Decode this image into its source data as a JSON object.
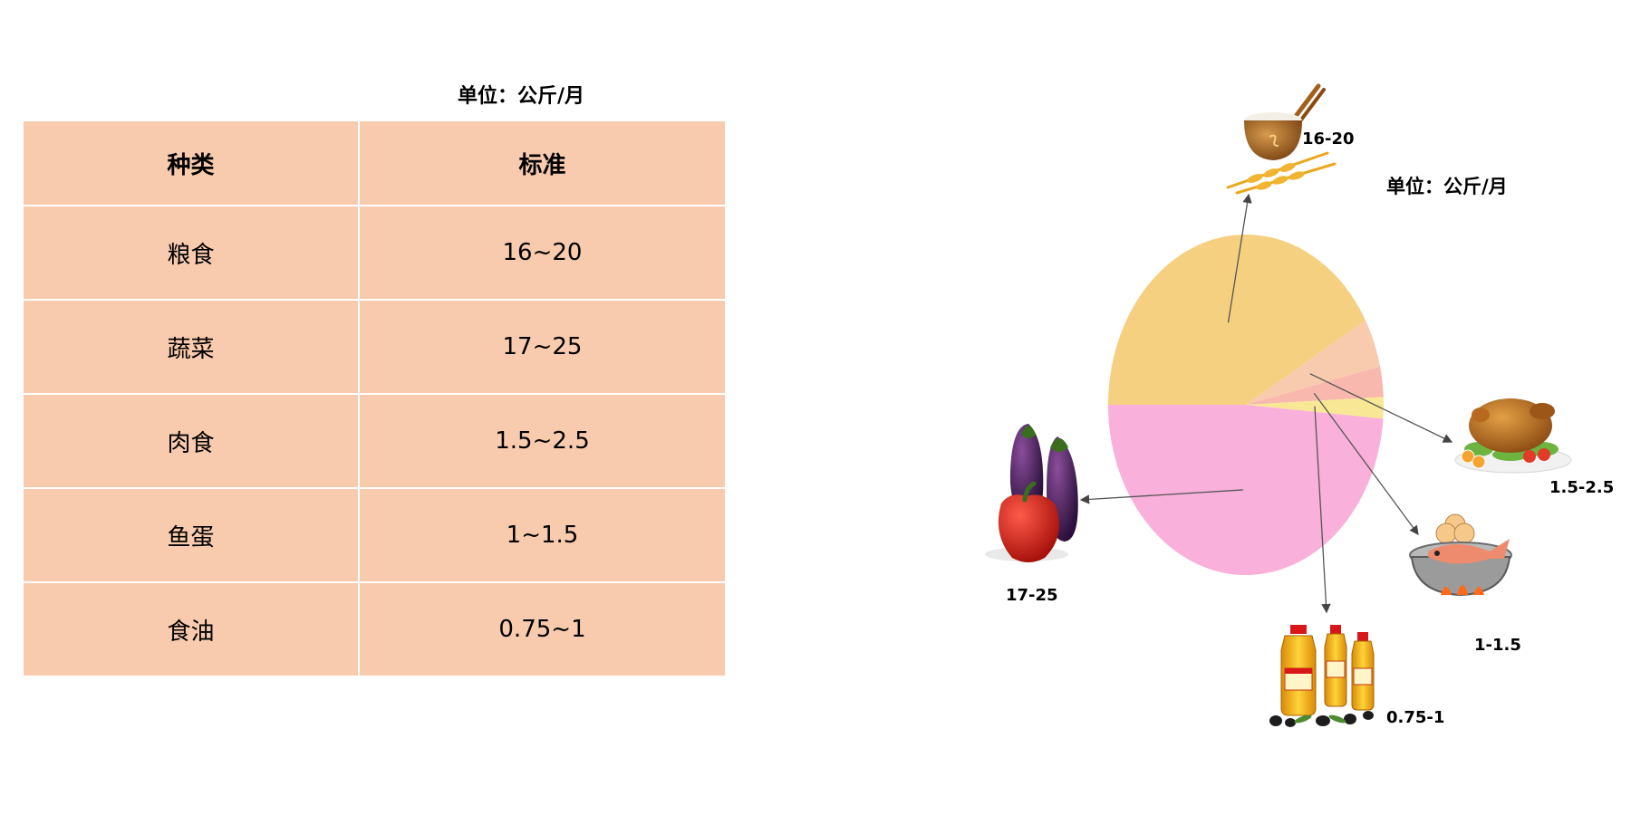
{
  "table": {
    "unit": "单位：公斤/月",
    "headers": [
      "种类",
      "标准"
    ],
    "rows": [
      {
        "category": "粮食",
        "standard": "16~20"
      },
      {
        "category": "蔬菜",
        "standard": "17~25"
      },
      {
        "category": "肉食",
        "standard": "1.5~2.5"
      },
      {
        "category": "鱼蛋",
        "standard": "1~1.5"
      },
      {
        "category": "食油",
        "standard": "0.75~1"
      }
    ]
  },
  "chart_data": {
    "type": "pie",
    "unit": "单位：公斤/月",
    "slices": [
      {
        "key": "grain",
        "label": "16-20",
        "value": 18,
        "color": "#f5d080",
        "icon": "rice-bowl-wheat-icon"
      },
      {
        "key": "meat",
        "label": "1.5-2.5",
        "value": 2,
        "color": "#f9cbae",
        "icon": "roast-chicken-icon"
      },
      {
        "key": "fish-egg",
        "label": "1-1.5",
        "value": 1.25,
        "color": "#f9b8ae",
        "icon": "fish-pot-eggs-icon"
      },
      {
        "key": "oil",
        "label": "0.75-1",
        "value": 0.875,
        "color": "#f8e896",
        "icon": "oil-bottles-icon"
      },
      {
        "key": "vegetables",
        "label": "17-25",
        "value": 21,
        "color": "#f9b0da",
        "icon": "eggplant-pepper-icon"
      }
    ],
    "start": "left-horizontal",
    "direction": "clockwise",
    "legend": "none"
  }
}
